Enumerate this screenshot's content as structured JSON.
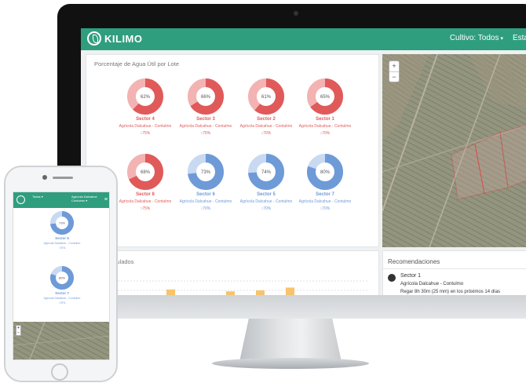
{
  "header": {
    "brand": "KILIMO",
    "nav": [
      {
        "label": "Cultivo: Todos",
        "caret": "▾"
      },
      {
        "label": "Esta"
      }
    ]
  },
  "percentage_card": {
    "title": "Porcentaje de Agua Útil por Lote",
    "lots": [
      {
        "name": "Sector 4",
        "farm": "Agrícola Dalcahue - Contulmo",
        "pct": "62%",
        "value": 62,
        "threshold": "↕75%",
        "status": "low"
      },
      {
        "name": "Sector 3",
        "farm": "Agrícola Dalcahue - Contulmo",
        "pct": "66%",
        "value": 66,
        "threshold": "↕75%",
        "status": "low"
      },
      {
        "name": "Sector 2",
        "farm": "Agrícola Dalcahue - Contulmo",
        "pct": "61%",
        "value": 61,
        "threshold": "↕70%",
        "status": "low"
      },
      {
        "name": "Sector 1",
        "farm": "Agrícola Dalcahue - Contulmo",
        "pct": "65%",
        "value": 65,
        "threshold": "↕70%",
        "status": "low"
      },
      {
        "name": "Sector 8",
        "farm": "Agrícola Dalcahue - Contulmo",
        "pct": "68%",
        "value": 68,
        "threshold": "↕75%",
        "status": "low"
      },
      {
        "name": "Sector 6",
        "farm": "Agrícola Dalcahue - Contulmo",
        "pct": "73%",
        "value": 73,
        "threshold": "↕70%",
        "status": "ok"
      },
      {
        "name": "Sector 5",
        "farm": "Agrícola Dalcahue - Contulmo",
        "pct": "74%",
        "value": 74,
        "threshold": "↕70%",
        "status": "ok"
      },
      {
        "name": "Sector 7",
        "farm": "Agrícola Dalcahue - Contulmo",
        "pct": "80%",
        "value": 80,
        "threshold": "↕70%",
        "status": "ok"
      }
    ]
  },
  "map": {
    "zoom_in": "+",
    "zoom_out": "−"
  },
  "riegos_card": {
    "title": "iegos acumulados",
    "bars": [
      0.55,
      0.45,
      0.5,
      0.65
    ]
  },
  "recommendations": {
    "title": "Recomendaciones",
    "items": [
      {
        "sector": "Sector 1",
        "farm": "Agrícola Dalcahue - Contulmo",
        "text": "Regar 8h 30m (25 mm) en los próximos 14 días"
      }
    ]
  },
  "phone": {
    "nav_crop": "Todos",
    "nav_farm": "Agrícola Dalcahue",
    "nav_farm2": "Contulmo",
    "lots": [
      {
        "name": "Sector 6",
        "farm": "Agrícola Dalcahue - Contulmo",
        "pct": "73%",
        "value": 73,
        "threshold": "↕70%"
      },
      {
        "name": "Sector 7",
        "farm": "Agrícola Dalcahue - Contulmo",
        "pct": "80%",
        "value": 80,
        "threshold": "↕70%"
      }
    ]
  },
  "colors": {
    "brand": "#2f9e7e",
    "low_ring": "#e05a5a",
    "low_track": "#f3b3b3",
    "ok_ring": "#6e9ad8",
    "ok_track": "#c9d9f2",
    "bar": "#f7c46c"
  },
  "icons": [
    "kilimo-leaf-icon",
    "caret-down-icon",
    "zoom-in-icon",
    "zoom-out-icon",
    "water-drop-icon",
    "hamburger-menu-icon"
  ]
}
